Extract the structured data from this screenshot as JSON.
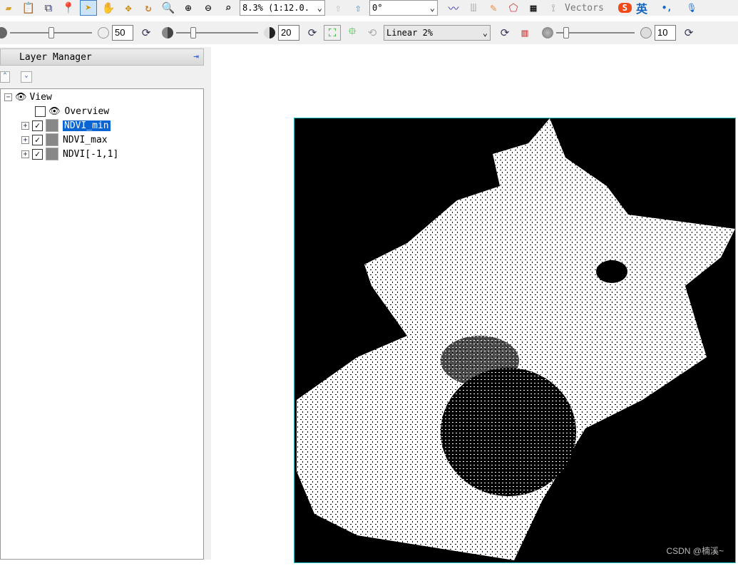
{
  "toolbar1": {
    "zoom_value": "8.3% (1:12.0.",
    "rotation_value": "0°",
    "vectors_label": "Vectors",
    "ime_label": "英"
  },
  "toolbar2": {
    "brightness": "50",
    "contrast": "20",
    "stretch": "Linear 2%",
    "transparency": "10"
  },
  "layer_manager": {
    "title": "Layer Manager",
    "root": "View",
    "items": [
      {
        "label": "Overview",
        "checked": false,
        "selected": false
      },
      {
        "label": "NDVI_min",
        "checked": true,
        "selected": true
      },
      {
        "label": "NDVI_max",
        "checked": true,
        "selected": false
      },
      {
        "label": "NDVI[-1,1]",
        "checked": true,
        "selected": false
      }
    ]
  },
  "watermark": "CSDN @楠溪~",
  "colors": {
    "selection": "#0a64d2",
    "map_border": "#1fc5c5"
  }
}
